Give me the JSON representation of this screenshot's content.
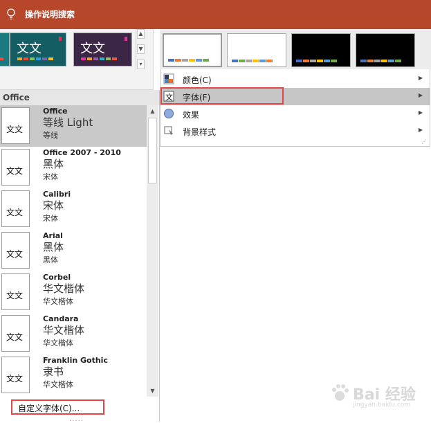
{
  "topbar": {
    "title": "操作说明搜索",
    "icon": "lightbulb-icon"
  },
  "gallery": {
    "thumb_glyph": "文文",
    "scroll_up": "▲",
    "scroll_down": "▼",
    "scroll_more": "▾"
  },
  "fonts_panel": {
    "header": "Office",
    "items": [
      {
        "name": "Office",
        "heading": "等线 Light",
        "body": "等线",
        "glyph": "文文",
        "selected": true
      },
      {
        "name": "Office 2007 - 2010",
        "heading": "黑体",
        "body": "宋体",
        "glyph": "文文",
        "selected": false
      },
      {
        "name": "Calibri",
        "heading": "宋体",
        "body": "宋体",
        "glyph": "文文",
        "selected": false
      },
      {
        "name": "Arial",
        "heading": "黑体",
        "body": "黑体",
        "glyph": "文文",
        "selected": false
      },
      {
        "name": "Corbel",
        "heading": "华文楷体",
        "body": "华文楷体",
        "glyph": "文文",
        "selected": false
      },
      {
        "name": "Candara",
        "heading": "华文楷体",
        "body": "华文楷体",
        "glyph": "文文",
        "selected": false
      },
      {
        "name": "Franklin Gothic",
        "heading": "隶书",
        "body": "华文楷体",
        "glyph": "文文",
        "selected": false
      }
    ],
    "customize": "自定义字体(C)...",
    "scroll_up": "▲",
    "scroll_down": "▼",
    "grip": "....."
  },
  "menu": {
    "items": [
      {
        "label": "颜色(C)",
        "icon": "colors-icon",
        "highlighted": false
      },
      {
        "label": "字体(F)",
        "icon": "fonts-icon",
        "highlighted": true
      },
      {
        "label": "效果",
        "icon": "effects-icon",
        "highlighted": false
      },
      {
        "label": "背景样式",
        "icon": "background-style-icon",
        "highlighted": false
      }
    ],
    "arrow": "▶",
    "grip": "⋰"
  },
  "colors": {
    "ribbon": "#b7472a",
    "highlight_box": "#e04848",
    "palette": [
      "#4472c4",
      "#ed7d31",
      "#a5a5a5",
      "#ffc000",
      "#5b9bd5",
      "#70ad47"
    ]
  },
  "watermark": {
    "text": "Bai 经验",
    "sub": "jingyan.baidu.com"
  }
}
